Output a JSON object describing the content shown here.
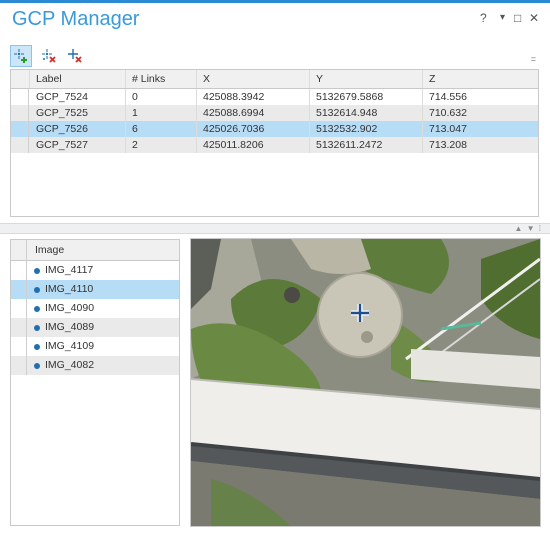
{
  "window": {
    "title": "GCP Manager",
    "help": "?",
    "menu": "▾",
    "restore": "□",
    "close": "✕"
  },
  "toolbar": {
    "buttons": [
      {
        "icon": "add-gcp-icon",
        "active": true
      },
      {
        "icon": "delete-gcp-icon",
        "active": false
      },
      {
        "icon": "delete-tiepoint-icon",
        "active": false
      }
    ],
    "more": "="
  },
  "gcp_table": {
    "columns": [
      "Label",
      "# Links",
      "X",
      "Y",
      "Z"
    ],
    "rows": [
      {
        "label": "GCP_7524",
        "links": "0",
        "x": "425088.3942",
        "y": "5132679.5868",
        "z": "714.556"
      },
      {
        "label": "GCP_7525",
        "links": "1",
        "x": "425088.6994",
        "y": "5132614.948",
        "z": "710.632"
      },
      {
        "label": "GCP_7526",
        "links": "6",
        "x": "425026.7036",
        "y": "5132532.902",
        "z": "713.047"
      },
      {
        "label": "GCP_7527",
        "links": "2",
        "x": "425011.8206",
        "y": "5132611.2472",
        "z": "713.208"
      }
    ],
    "selected_row": 2
  },
  "splitter": {
    "controls": "▲ ▼ ⁞"
  },
  "image_list": {
    "header": "Image",
    "items": [
      "IMG_4117",
      "IMG_4110",
      "IMG_4090",
      "IMG_4089",
      "IMG_4109",
      "IMG_4082"
    ],
    "selected_index": 1
  },
  "viewer": {
    "crosshair_icon": "crosshair-icon"
  },
  "colors": {
    "accent": "#2a8ad4",
    "title": "#3a9ad9",
    "selection": "#b7dcf6",
    "dot": "#1f6fb3"
  }
}
